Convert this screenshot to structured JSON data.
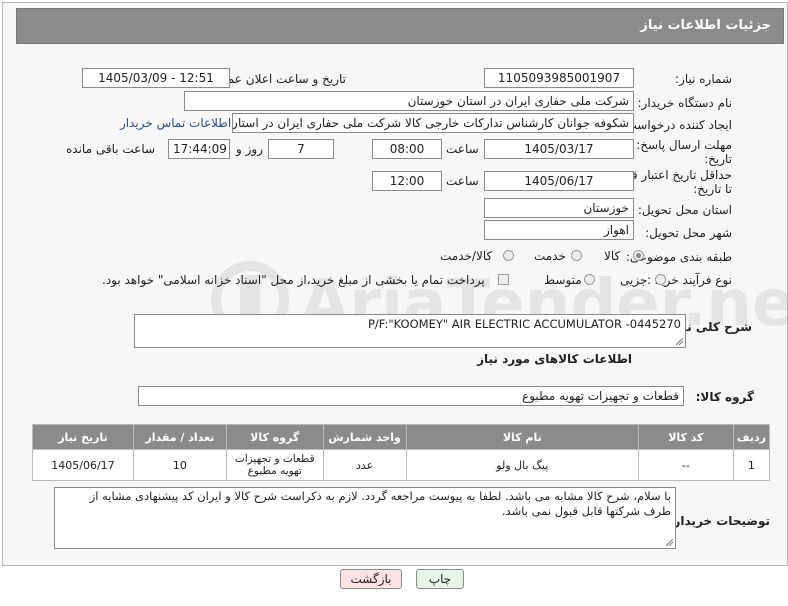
{
  "header": {
    "title": "جزئیات اطلاعات نیاز"
  },
  "fields": {
    "need_number_label": "شماره نیاز:",
    "need_number": "1105093985001907",
    "announce_label": "تاریخ و ساعت اعلان عمومی:",
    "announce_value": "1405/03/09 - 12:51",
    "buyer_org_label": "نام دستگاه خریدار:",
    "buyer_org": "شرکت ملی حفاری ایران در استان خوزستان",
    "requester_label": "ایجاد کننده درخواست:",
    "requester": "شکوفه جوانان کارشناس تداركات خارجی کالا شرکت ملی حفاری ایران در استان",
    "contact_link": "اطلاعات تماس خریدار",
    "deadline_label_1": "مهلت ارسال پاسخ: تا",
    "deadline_label_2": "تاریخ:",
    "deadline_date": "1405/03/17",
    "time_word": "ساعت",
    "deadline_time": "08:00",
    "days_value": "7",
    "days_word": "روز و",
    "remaining_time": "17:44:09",
    "remaining_word": "ساعت باقی مانده",
    "price_label_1": "حداقل تاریخ اعتبار قیمت:",
    "price_label_2": "تا تاریخ:",
    "price_date": "1405/06/17",
    "price_time": "12:00",
    "province_label": "استان محل تحویل:",
    "province": "خوزستان",
    "city_label": "شهر محل تحویل:",
    "city": "اهواز",
    "category_label": "طبقه بندی موضوعی:",
    "category_options": [
      "کالا",
      "خدمت",
      "کالا/خدمت"
    ],
    "process_label": "نوع فرآیند خرید :",
    "process_options": [
      "جزیی",
      "متوسط"
    ],
    "payment_note": "پرداخت تمام یا بخشی از مبلغ خرید،از محل \"اسناد خزانه اسلامی\" خواهد بود.",
    "summary_label": "شرح کلی نیاز:",
    "summary": "P/F:\"KOOMEY\" AIR ELECTRIC ACCUMULATOR -0445270",
    "goods_info_title": "اطلاعات کالاهای مورد نیاز",
    "goods_group_label": "گروه کالا:",
    "goods_group": "قطعات و تجهیزات تهویه مطبوع",
    "buyer_notes_label": "توضیحات خریدار:",
    "buyer_notes": "با سلام، شرح کالا مشابه می باشد. لطفا به پیوست مراجعه گردد. لازم به ذکراست شرح کالا و ایران کد  پیشنهادی مشابه از طرف شرکتها قابل قبول نمی باشد."
  },
  "table": {
    "headers": [
      "ردیف",
      "کد کالا",
      "نام کالا",
      "واحد شمارش",
      "گروه کالا",
      "تعداد / مقدار",
      "تاریخ نیاز"
    ],
    "rows": [
      [
        "1",
        "--",
        "پیگ بال ولو",
        "عدد",
        "قطعات و تجهیزات تهویه مطبوع",
        "10",
        "1405/06/17"
      ]
    ]
  },
  "buttons": {
    "print": "چاپ",
    "back": "بازگشت"
  },
  "watermark": {
    "text": "AriaTender.neT"
  },
  "colors": {
    "header_bg": "#8b8b8b",
    "link": "#2a4f8a",
    "print_bg": "#e6f6e6",
    "back_bg": "#fbe3e3"
  }
}
